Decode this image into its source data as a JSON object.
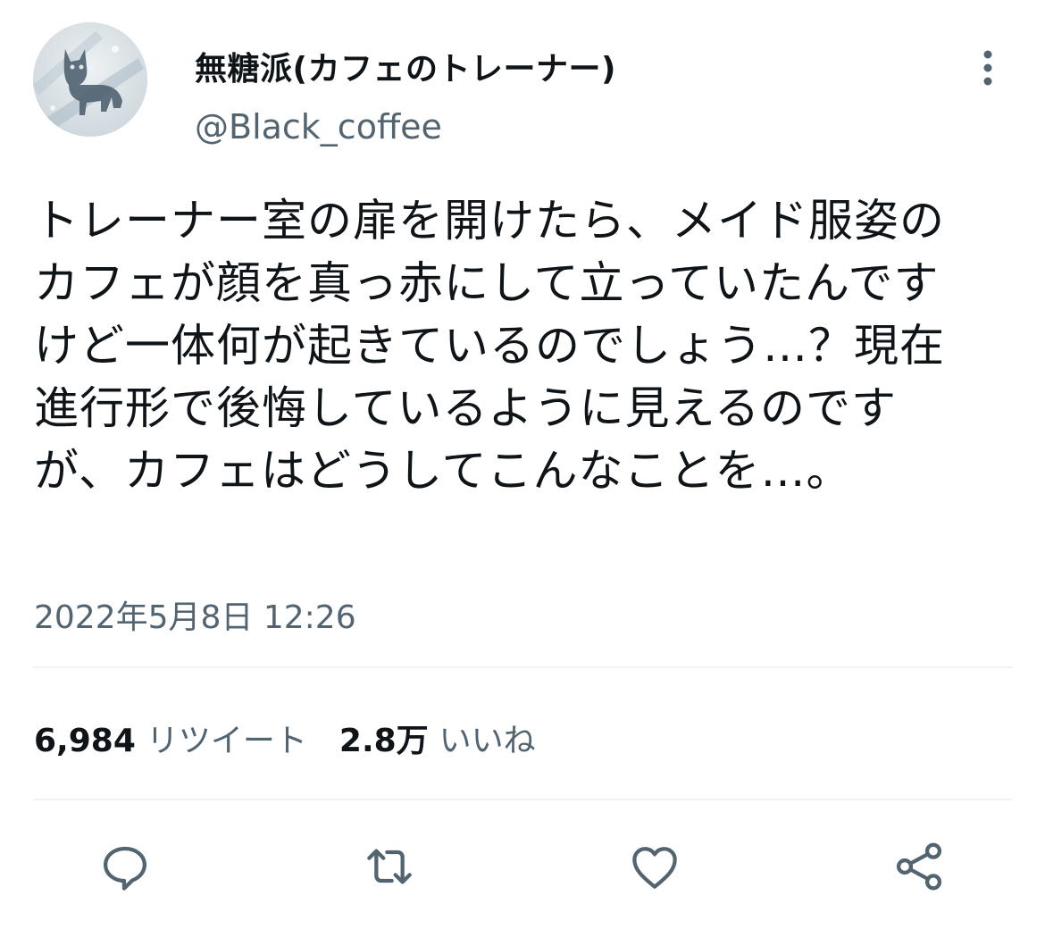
{
  "user": {
    "display_name": "無糖派(カフェのトレーナー)",
    "handle": "@Black_coffee"
  },
  "tweet": {
    "text_lines": [
      "トレーナー室の扉を開けたら、メイド服姿の",
      "カフェが顔を真っ赤にして立っていたんです",
      "けど一体何が起きているのでしょう…？現在",
      "進行形で後悔しているように見えるのです",
      "が、カフェはどうしてこんなことを…。"
    ],
    "timestamp": "2022年5月8日 12:26"
  },
  "stats": {
    "retweets_count": "6,984",
    "retweets_label": "リツイート",
    "likes_count": "2.8万",
    "likes_label": "いいね"
  },
  "icons": {
    "more": "more-vertical-icon",
    "reply": "reply-icon",
    "retweet": "retweet-icon",
    "like": "heart-icon",
    "share": "share-icon"
  },
  "colors": {
    "text_primary": "#0f1419",
    "text_secondary": "#536471",
    "icon": "#536471",
    "divider": "#eff3f4"
  }
}
